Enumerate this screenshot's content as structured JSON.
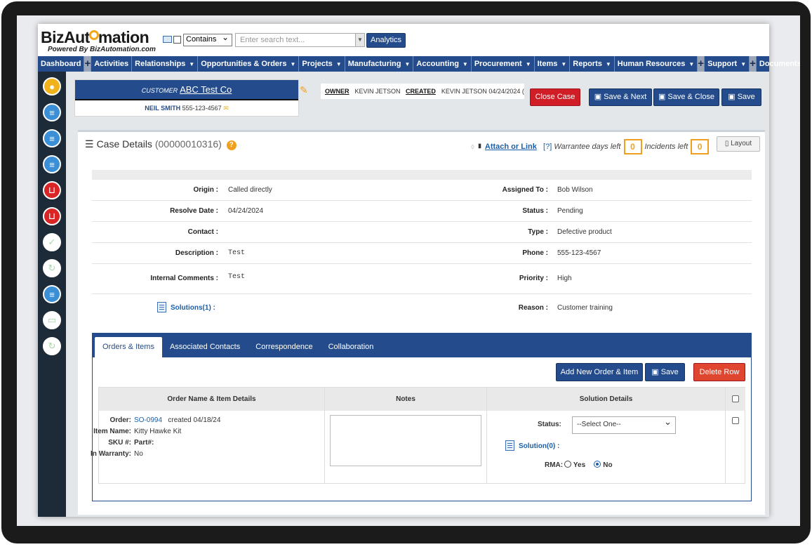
{
  "brand": {
    "logo": "BizAutomation",
    "tagline": "Powered By BizAutomation.com"
  },
  "search": {
    "filter": "Contains",
    "placeholder": "Enter search text...",
    "analytics_label": "Analytics"
  },
  "nav": [
    "Dashboard",
    "Activities",
    "Relationships",
    "Opportunities & Orders",
    "Projects",
    "Manufacturing",
    "Accounting",
    "Procurement",
    "Items",
    "Reports",
    "Human Resources",
    "Support",
    "Documents"
  ],
  "customer": {
    "label": "CUSTOMER",
    "name": "ABC Test Co",
    "contact": "NEIL SMITH",
    "phone": "555-123-4567"
  },
  "owner": {
    "owner_label": "OWNER",
    "owner": "KEVIN JETSON",
    "created_label": "CREATED",
    "created": "KEVIN JETSON 04/24/2024 ("
  },
  "actions": {
    "close_case": "Close Case",
    "save_next": "Save & Next",
    "save_close": "Save & Close",
    "save": "Save"
  },
  "case": {
    "title": "Case Details",
    "number": "(00000010316)",
    "attach": "Attach or Link",
    "warrantee_prefix": "[?]",
    "warrantee_label": "Warrantee days left",
    "warrantee_days": "0",
    "incidents_label": "Incidents left",
    "incidents": "0",
    "layout": "Layout"
  },
  "fields": {
    "origin_l": "Origin :",
    "origin": "Called directly",
    "assigned_l": "Assigned To :",
    "assigned": "Bob Wilson",
    "resolve_l": "Resolve Date :",
    "resolve": "04/24/2024",
    "status_l": "Status :",
    "status": "Pending",
    "contact_l": "Contact :",
    "contact": "",
    "type_l": "Type :",
    "type": "Defective product",
    "desc_l": "Description :",
    "desc": "Test",
    "phone_l": "Phone :",
    "phone": "555-123-4567",
    "comments_l": "Internal Comments :",
    "comments": "Test",
    "priority_l": "Priority :",
    "priority": "High",
    "solutions": "Solutions(1) :",
    "reason_l": "Reason :",
    "reason": "Customer training"
  },
  "tabs": [
    "Orders & Items",
    "Associated Contacts",
    "Correspondence",
    "Collaboration"
  ],
  "tab_actions": {
    "add": "Add New Order & Item",
    "save": "Save",
    "delete": "Delete Row"
  },
  "grid": {
    "headers": [
      "Order Name & Item Details",
      "Notes",
      "Solution Details"
    ],
    "row": {
      "order_l": "Order:",
      "order": "SO-0994",
      "created": "created  04/18/24",
      "item_l": "Item Name:",
      "item": "Kitty Hawke Kit",
      "sku_l": "SKU #:",
      "part_l": "Part#:",
      "warranty_l": "In Warranty:",
      "warranty": "No",
      "status_l": "Status:",
      "status_sel": "--Select One--",
      "solution": "Solution(0) :",
      "rma_l": "RMA:",
      "yes": "Yes",
      "no": "No"
    }
  }
}
